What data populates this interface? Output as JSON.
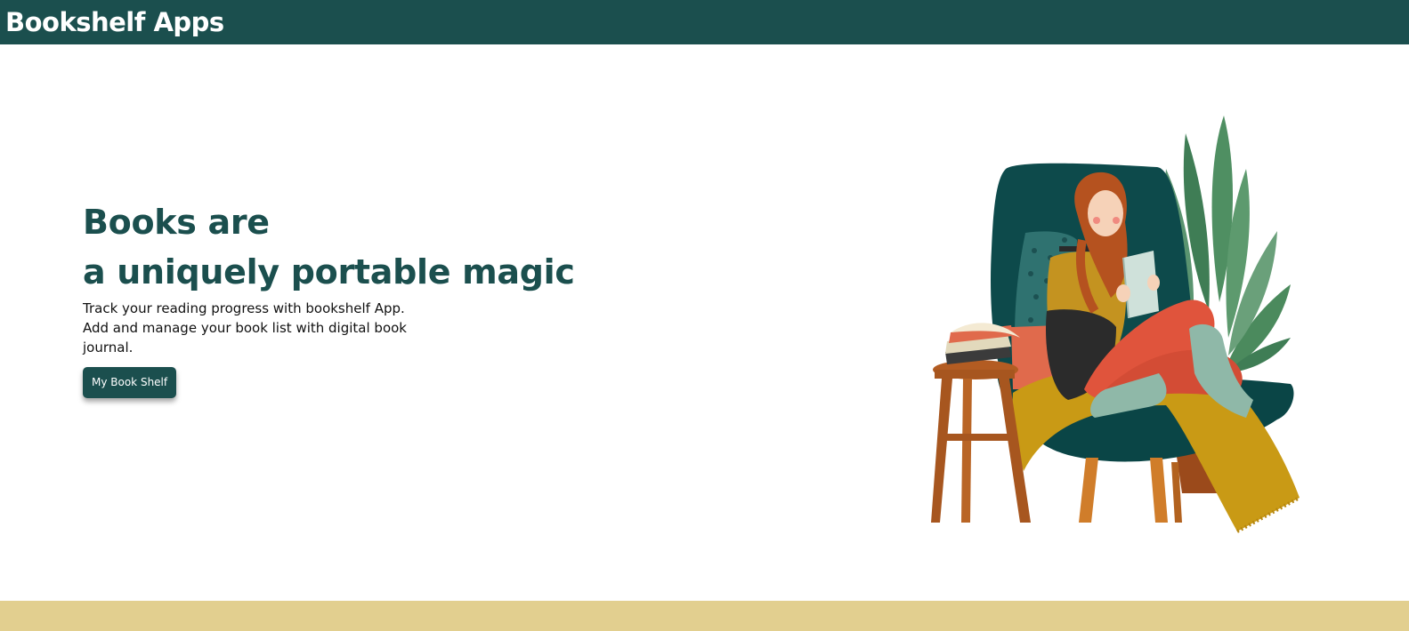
{
  "header": {
    "title": "Bookshelf Apps"
  },
  "hero": {
    "headline_line1": "Books are",
    "headline_line2": "a uniquely portable magic",
    "description": "Track your reading progress with bookshelf App. Add and manage your book list with digital book journal.",
    "button_label": "My Book Shelf"
  },
  "illustration": {
    "subject": "woman reading a book in an armchair next to a plant and a stool with books"
  },
  "colors": {
    "primary": "#1b4f4e",
    "footer": "#e2cf8f",
    "chair": "#0d4a4b",
    "throw": "#c99a15",
    "stool": "#a7561f"
  }
}
